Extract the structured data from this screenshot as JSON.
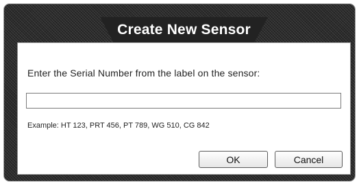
{
  "dialog": {
    "title": "Create New Sensor",
    "instruction": "Enter the Serial Number from the label on the sensor:",
    "serial_input_value": "",
    "serial_input_placeholder": "",
    "example": "Example: HT 123, PRT 456, PT 789, WG 510, CG 842",
    "ok_label": "OK",
    "cancel_label": "Cancel"
  }
}
